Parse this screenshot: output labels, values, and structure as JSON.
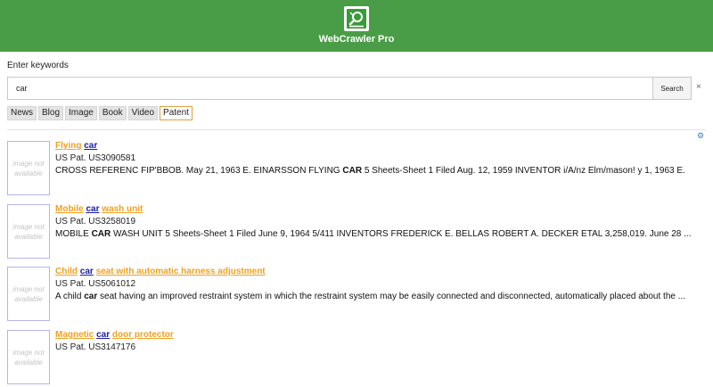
{
  "app": {
    "title": "WebCrawler Pro",
    "logo_icon": "magnifier-pencil-icon"
  },
  "colors": {
    "header": "#4a9d47",
    "title_link": "#f0a020",
    "keyword_link": "#1a1aa8",
    "thumb_border": "#b7b4ee"
  },
  "search": {
    "label": "Enter keywords",
    "value": "car",
    "button_label": "Search",
    "clear_label": "×"
  },
  "tabs": [
    {
      "label": "News",
      "active": false
    },
    {
      "label": "Blog",
      "active": false
    },
    {
      "label": "Image",
      "active": false
    },
    {
      "label": "Book",
      "active": false
    },
    {
      "label": "Video",
      "active": false
    },
    {
      "label": "Patent",
      "active": true
    }
  ],
  "settings_icon": "gear-icon",
  "results": [
    {
      "thumb_text": "image not available",
      "title_parts": [
        {
          "text": "Flying",
          "hl": false
        },
        {
          "text": "car",
          "hl": true
        }
      ],
      "id": "US Pat. US3090581",
      "snippet_parts": [
        {
          "text": "CROSS REFERENC FIP'BBOB. May 21, 1963 E. EINARSSON FLYING ",
          "bold": false
        },
        {
          "text": "CAR",
          "bold": true
        },
        {
          "text": " 5 Sheets-Sheet 1 Filed Aug. 12, 1959 INVENTOR i/A/nz Elm/mason! y 1, 1963 E.",
          "bold": false
        }
      ]
    },
    {
      "thumb_text": "image not available",
      "title_parts": [
        {
          "text": "Mobile",
          "hl": false
        },
        {
          "text": "car",
          "hl": true
        },
        {
          "text": "wash unit",
          "hl": false
        }
      ],
      "id": "US Pat. US3258019",
      "snippet_parts": [
        {
          "text": "MOBILE ",
          "bold": false
        },
        {
          "text": "CAR",
          "bold": true
        },
        {
          "text": " WASH UNIT 5 Sheets-Sheet 1 Filed June 9, 1964 5/411 INVENTORS FREDERICK E. BELLAS ROBERT A. DECKER ETAL 3,258,019. June 28 ...",
          "bold": false
        }
      ]
    },
    {
      "thumb_text": "image not available",
      "title_parts": [
        {
          "text": "Child",
          "hl": false
        },
        {
          "text": "car",
          "hl": true
        },
        {
          "text": "seat with automatic harness adjustment",
          "hl": false
        }
      ],
      "id": "US Pat. US5061012",
      "snippet_parts": [
        {
          "text": "A child ",
          "bold": false
        },
        {
          "text": "car",
          "bold": true
        },
        {
          "text": " seat having an improved restraint system in which the restraint system may be easily connected and disconnected, automatically placed about the ...",
          "bold": false
        }
      ]
    },
    {
      "thumb_text": "image not available",
      "title_parts": [
        {
          "text": "Magnetic",
          "hl": false
        },
        {
          "text": "car",
          "hl": true
        },
        {
          "text": "door protector",
          "hl": false
        }
      ],
      "id": "US Pat. US3147176",
      "snippet_parts": []
    }
  ]
}
